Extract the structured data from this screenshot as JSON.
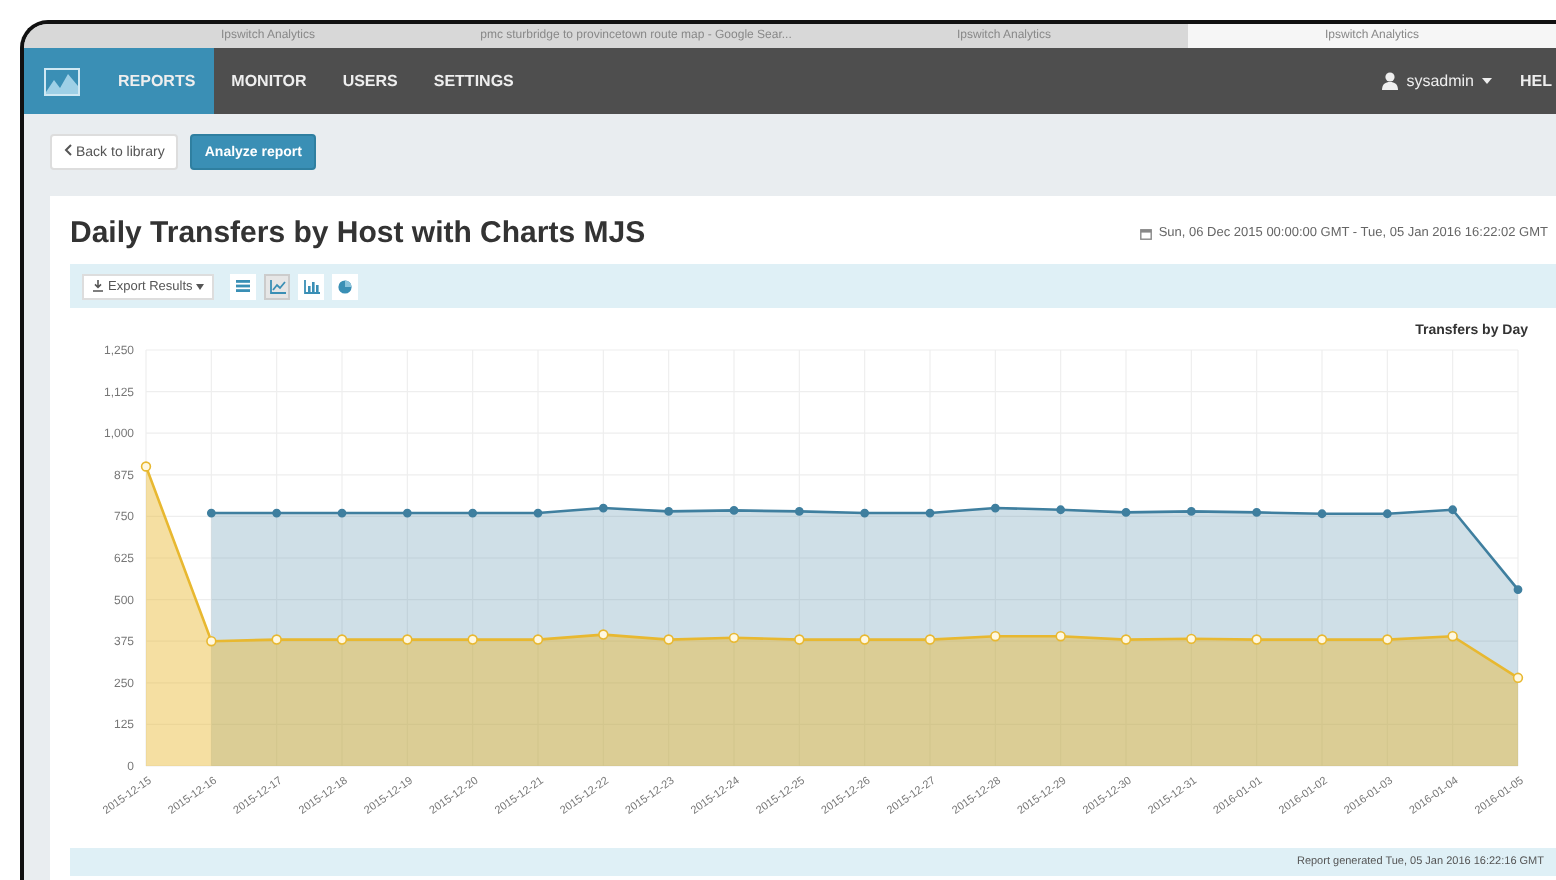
{
  "browser_tabs": [
    {
      "label": "Ipswitch Analytics",
      "selected": false
    },
    {
      "label": "pmc sturbridge to provincetown route map - Google Sear...",
      "selected": false
    },
    {
      "label": "Ipswitch Analytics",
      "selected": false
    },
    {
      "label": "Ipswitch Analytics",
      "selected": true
    }
  ],
  "nav": {
    "items": [
      {
        "label": "REPORTS",
        "selected": true
      },
      {
        "label": "MONITOR",
        "selected": false
      },
      {
        "label": "USERS",
        "selected": false
      },
      {
        "label": "SETTINGS",
        "selected": false
      }
    ],
    "user": "sysadmin",
    "help": "HEL"
  },
  "actions": {
    "back": "Back to library",
    "analyze": "Analyze report"
  },
  "report": {
    "title": "Daily Transfers by Host with Charts MJS",
    "date_range": "Sun, 06 Dec 2015 00:00:00 GMT - Tue, 05 Jan 2016 16:22:02 GMT",
    "export": "Export Results",
    "views": [
      {
        "kind": "table",
        "selected": false
      },
      {
        "kind": "line",
        "selected": true
      },
      {
        "kind": "bar",
        "selected": false
      },
      {
        "kind": "pie",
        "selected": false
      }
    ],
    "chart_data": {
      "type": "area",
      "title": "Transfers by Day",
      "categories": [
        "2015-12-15",
        "2015-12-16",
        "2015-12-17",
        "2015-12-18",
        "2015-12-19",
        "2015-12-20",
        "2015-12-21",
        "2015-12-22",
        "2015-12-23",
        "2015-12-24",
        "2015-12-25",
        "2015-12-26",
        "2015-12-27",
        "2015-12-28",
        "2015-12-29",
        "2015-12-30",
        "2015-12-31",
        "2016-01-01",
        "2016-01-02",
        "2016-01-03",
        "2016-01-04",
        "2016-01-05"
      ],
      "grid": true,
      "series": [
        {
          "color": "#3f7f9f",
          "values": [
            null,
            760,
            760,
            760,
            760,
            760,
            760,
            775,
            765,
            768,
            765,
            760,
            760,
            775,
            770,
            762,
            765,
            762,
            758,
            758,
            770,
            530
          ]
        },
        {
          "color": "#e8b830",
          "values": [
            900,
            375,
            380,
            380,
            380,
            380,
            380,
            395,
            380,
            385,
            380,
            380,
            380,
            390,
            390,
            380,
            382,
            380,
            380,
            380,
            390,
            265
          ]
        }
      ],
      "ylim": [
        0,
        1250
      ],
      "yticks": [
        {
          "value": 0,
          "label": "0"
        },
        {
          "value": 125,
          "label": "125"
        },
        {
          "value": 250,
          "label": "250"
        },
        {
          "value": 375,
          "label": "375"
        },
        {
          "value": 500,
          "label": "500"
        },
        {
          "value": 625,
          "label": "625"
        },
        {
          "value": 750,
          "label": "750"
        },
        {
          "value": 875,
          "label": "875"
        },
        {
          "value": 1000,
          "label": "1,000"
        },
        {
          "value": 1125,
          "label": "1,125"
        },
        {
          "value": 1250,
          "label": "1,250"
        }
      ]
    },
    "footer": "Report generated Tue, 05 Jan 2016 16:22:16 GMT"
  }
}
